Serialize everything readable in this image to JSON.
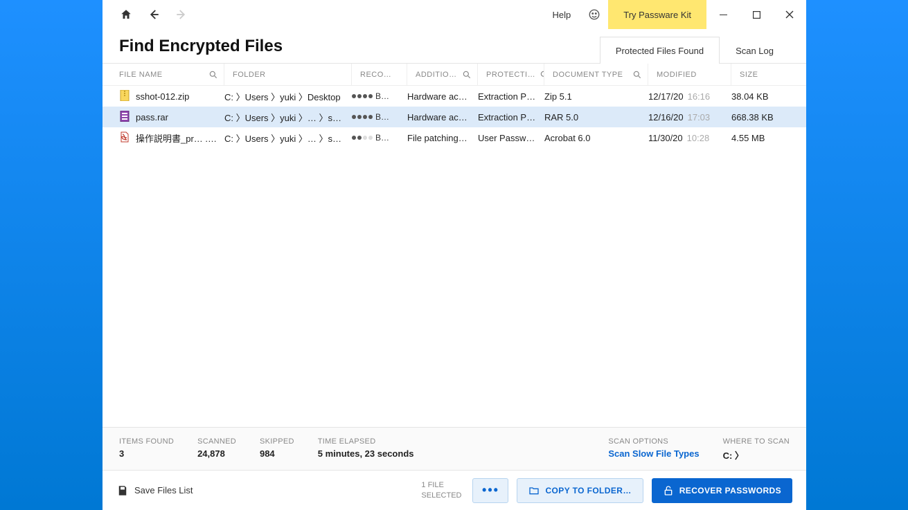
{
  "titlebar": {
    "help_label": "Help",
    "try_label": "Try Passware Kit"
  },
  "header": {
    "title": "Find Encrypted Files",
    "tabs": [
      {
        "label": "Protected Files Found",
        "active": true
      },
      {
        "label": "Scan Log",
        "active": false
      }
    ]
  },
  "columns": {
    "file_name": "FILE NAME",
    "folder": "FOLDER",
    "recovery": "RECO…",
    "additional": "ADDITIO…",
    "protection": "PROTECTI…",
    "document_type": "DOCUMENT TYPE",
    "modified": "MODIFIED",
    "size": "SIZE"
  },
  "rows": [
    {
      "icon": "zip",
      "file_name": "sshot-012.zip",
      "folder": "C: 〉Users 〉yuki 〉Desktop",
      "recovery_dots": 4,
      "recovery_label": "B…",
      "additional": "Hardware ac…",
      "protection": "Extraction Pa…",
      "doc_type": "Zip 5.1",
      "mod_date": "12/17/20",
      "mod_time": "16:16",
      "size": "38.04 KB",
      "selected": false
    },
    {
      "icon": "rar",
      "file_name": "pass.rar",
      "folder": "C: 〉Users 〉yuki 〉… 〉sample",
      "recovery_dots": 4,
      "recovery_label": "B…",
      "additional": "Hardware ac…",
      "protection": "Extraction Pa…",
      "doc_type": "RAR 5.0",
      "mod_date": "12/16/20",
      "mod_time": "17:03",
      "size": "668.38 KB",
      "selected": true
    },
    {
      "icon": "pdf",
      "file_name": "操作説明書_pr…  .pdf",
      "folder": "C: 〉Users 〉yuki 〉… 〉sample",
      "recovery_dots": 2,
      "recovery_label": "B…",
      "additional": "File patching…",
      "protection": "User Passwo…",
      "doc_type": "Acrobat 6.0",
      "mod_date": "11/30/20",
      "mod_time": "10:28",
      "size": "4.55 MB",
      "selected": false
    }
  ],
  "status": {
    "items_found_label": "ITEMS FOUND",
    "items_found_value": "3",
    "scanned_label": "SCANNED",
    "scanned_value": "24,878",
    "skipped_label": "SKIPPED",
    "skipped_value": "984",
    "time_label": "TIME ELAPSED",
    "time_value": "5 minutes, 23 seconds",
    "scan_options_label": "SCAN OPTIONS",
    "scan_options_value": "Scan Slow File Types",
    "where_label": "WHERE TO SCAN",
    "where_value": "C: 〉"
  },
  "actions": {
    "save_label": "Save Files List",
    "selection_info": "1 FILE\nSELECTED",
    "copy_label": "COPY TO FOLDER…",
    "recover_label": "RECOVER PASSWORDS"
  }
}
